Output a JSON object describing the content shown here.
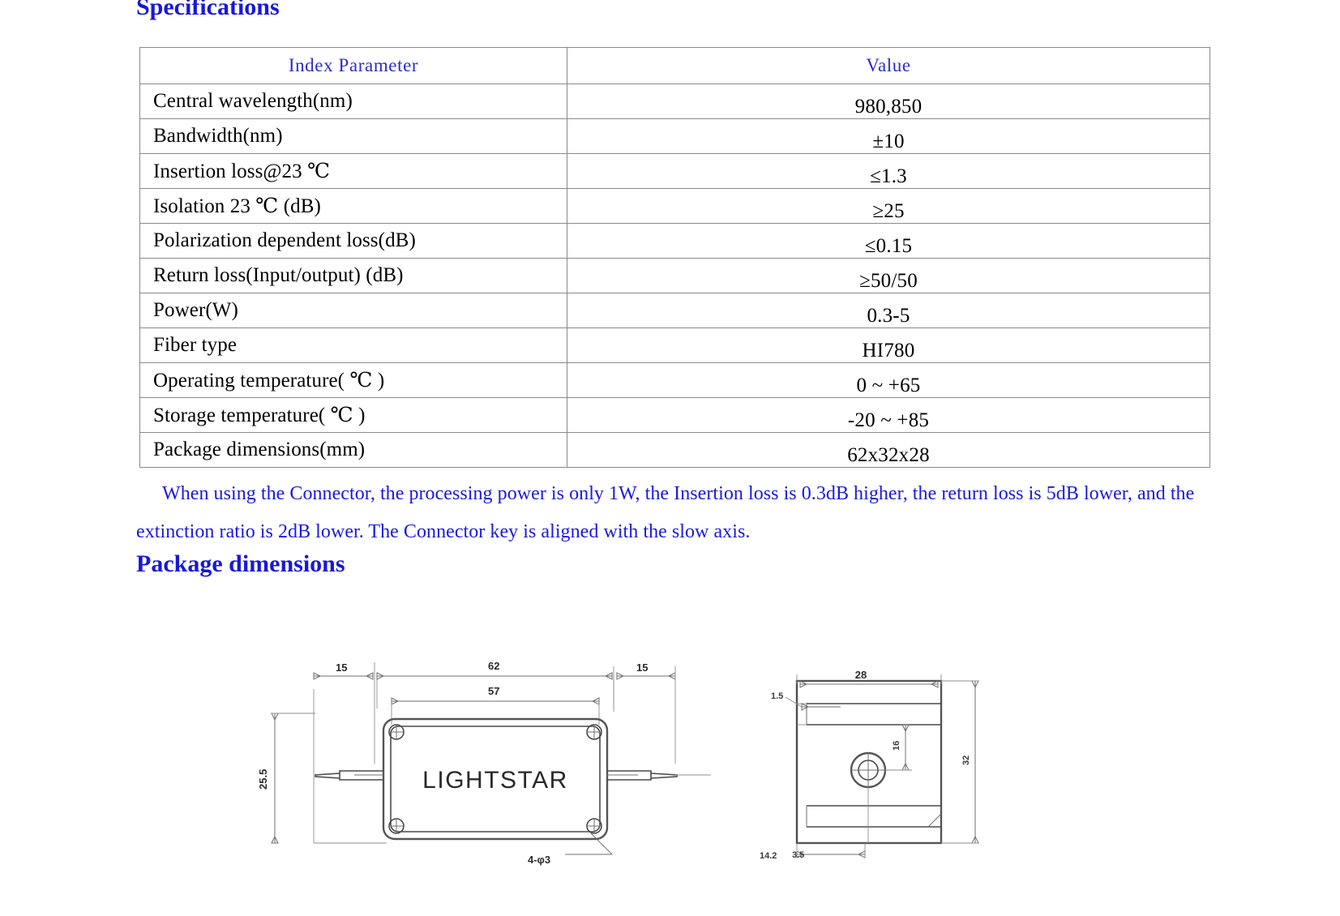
{
  "headings": {
    "specifications": "Specifications",
    "package_dimensions": "Package dimensions"
  },
  "spec_table": {
    "columns": [
      "Index Parameter",
      "Value"
    ],
    "rows": [
      {
        "label": "Central wavelength(nm)",
        "value": "980,850"
      },
      {
        "label": "Bandwidth(nm)",
        "value": "±10"
      },
      {
        "label": "Insertion loss@23 ℃",
        "value": "≤1.3"
      },
      {
        "label": "Isolation 23 ℃ (dB)",
        "value": "≥25"
      },
      {
        "label": "Polarization dependent loss(dB)",
        "value": "≤0.15"
      },
      {
        "label": "Return loss(Input/output) (dB)",
        "value": "≥50/50"
      },
      {
        "label": "Power(W)",
        "value": "0.3-5"
      },
      {
        "label": "Fiber type",
        "value": "HI780"
      },
      {
        "label": "Operating temperature( ℃ )",
        "value": "0 ~ +65"
      },
      {
        "label": "Storage temperature( ℃ )",
        "value": "-20 ~ +85"
      },
      {
        "label": "Package dimensions(mm)",
        "value": "62x32x28"
      }
    ]
  },
  "note": "When using the Connector, the processing power is only 1W, the Insertion loss is 0.3dB higher, the return loss is 5dB lower, and the extinction ratio is 2dB lower. The Connector key is aligned with the slow axis.",
  "drawing": {
    "brand_label": "LIGHTSTAR",
    "front_view": {
      "dim_left_pigtail": "15",
      "dim_overall_length": "62",
      "dim_body_length": "57",
      "dim_right_pigtail": "15",
      "dim_height": "25.5",
      "hole_callout": "4-φ3"
    },
    "side_view": {
      "dim_width": "28",
      "dim_wall": "1.5",
      "dim_hole_from_top": "16",
      "dim_total_height": "32",
      "dim_bottom_offset": "14.2",
      "dim_bottom_small": "3.5"
    }
  },
  "colors": {
    "heading_blue": "#1818d8",
    "table_header_blue": "#2b2bcf",
    "note_blue": "#1a1ae0",
    "table_border": "#8a8a8a",
    "body_text": "#000000",
    "drawing_line": "#6f6f6f"
  }
}
